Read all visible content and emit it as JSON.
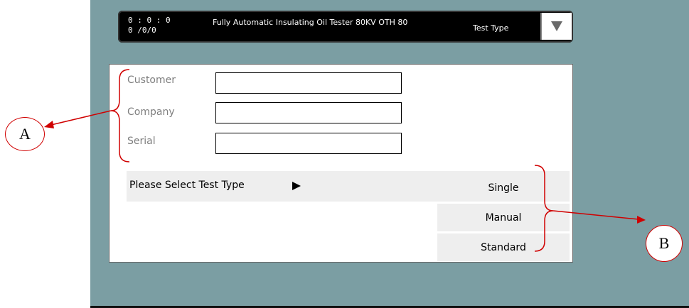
{
  "header": {
    "clock_time": "0 : 0 : 0",
    "clock_date": "0 /0/0",
    "app_title": "Fully Automatic Insulating Oil Tester 80KV OTH 80",
    "section_label": "Test Type"
  },
  "form": {
    "fields": [
      {
        "label": "Customer",
        "value": ""
      },
      {
        "label": "Company",
        "value": ""
      },
      {
        "label": "Serial",
        "value": ""
      }
    ]
  },
  "test_selection": {
    "prompt": "Please Select Test Type",
    "options": [
      "Single",
      "Manual",
      "Standard"
    ]
  },
  "callouts": {
    "a": "A",
    "b": "B"
  },
  "colors": {
    "device_bg": "#7b9ea3",
    "annotation": "#d00000",
    "label_gray": "#7f7f7f",
    "button_bg": "#eeeeee"
  }
}
